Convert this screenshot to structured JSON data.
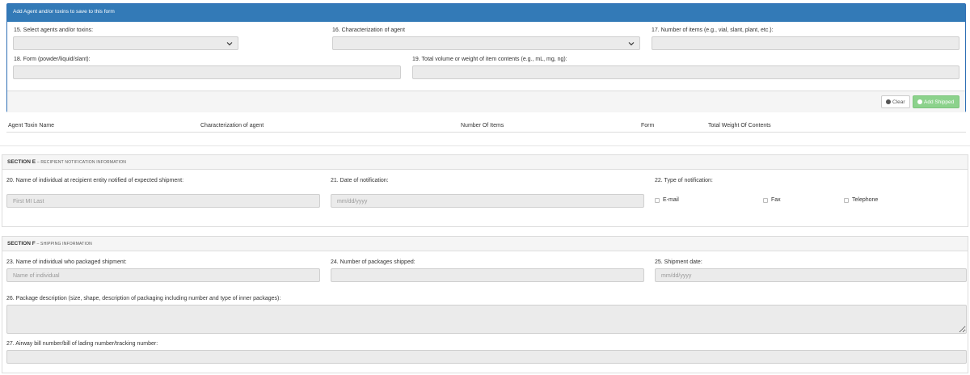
{
  "agent_panel": {
    "title": "Add Agent and/or toxins to save to this form",
    "fields": {
      "select_agents_label": "15. Select agents and/or toxins:",
      "characterization_label": "16. Characterization of agent",
      "number_items_label": "17. Number of items (e.g., vial, slant, plant, etc.):",
      "form_label": "18. Form (powder/liquid/slant):",
      "total_volume_label": "19. Total volume or weight of item contents (e.g., mL, mg, ng):"
    },
    "buttons": {
      "clear": "Clear",
      "add_shipped": "Add Shipped"
    },
    "colors": {
      "header": "#337ab7",
      "add_button": "#8cd28c"
    }
  },
  "agent_table": {
    "columns": [
      "Agent Toxin Name",
      "Characterization of agent",
      "Number Of Items",
      "Form",
      "Total Weight Of Contents"
    ]
  },
  "section_e": {
    "title": "SECTION E",
    "subtitle": "– RECIPIENT NOTIFICATION INFORMATION",
    "name_label": "20. Name of individual at recipient entity notified of expected shipment:",
    "name_placeholder": "First MI Last",
    "date_label": "21. Date of notification:",
    "date_placeholder": "mm/dd/yyyy",
    "type_label": "22. Type of notification:",
    "options": [
      "E-mail",
      "Fax",
      "Telephone"
    ]
  },
  "section_f": {
    "title": "SECTION F",
    "subtitle": "– SHIPPING INFORMATION",
    "packager_label": "23. Name of individual who packaged shipment:",
    "packager_placeholder": "Name of individual",
    "packages_label": "24. Number of packages shipped:",
    "ship_date_label": "25. Shipment date:",
    "ship_date_placeholder": "mm/dd/yyyy",
    "description_label": "26. Package description (size, shape, description of packaging including number and type of inner packages):",
    "tracking_label": "27. Airway bill number/bill of lading number/tracking number:"
  }
}
